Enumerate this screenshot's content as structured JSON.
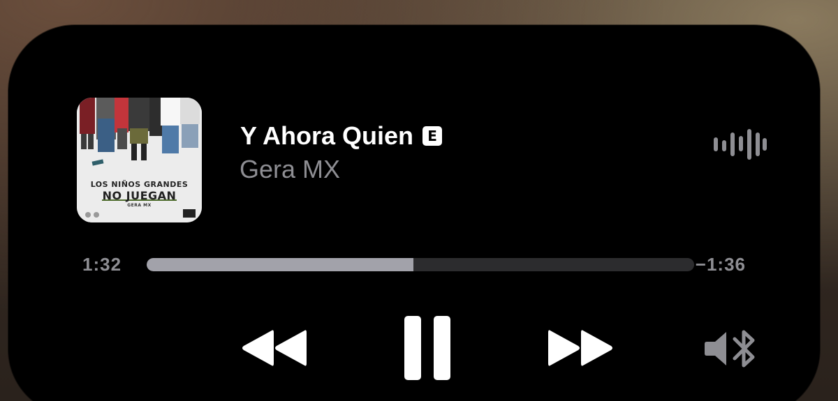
{
  "now_playing": {
    "title": "Y Ahora Quien",
    "explicit_badge": "E",
    "artist": "Gera MX",
    "artwork": {
      "line1": "LOS NIÑOS GRANDES",
      "line2": "NO JUEGAN",
      "line3": "GERA MX"
    }
  },
  "progress": {
    "elapsed": "1:32",
    "remaining": "−1:36",
    "fraction": 0.487
  },
  "controls": {
    "rewind_icon": "backward-icon",
    "pause_icon": "pause-icon",
    "forward_icon": "forward-icon",
    "audio_route_icon": "speaker-bluetooth-icon",
    "waveform_icon": "waveform-icon"
  },
  "colors": {
    "background": "#000000",
    "primary_text": "#ffffff",
    "secondary_text": "#8e8e93",
    "progress_fill": "#a2a2aa",
    "progress_track": "#2c2c2e"
  }
}
